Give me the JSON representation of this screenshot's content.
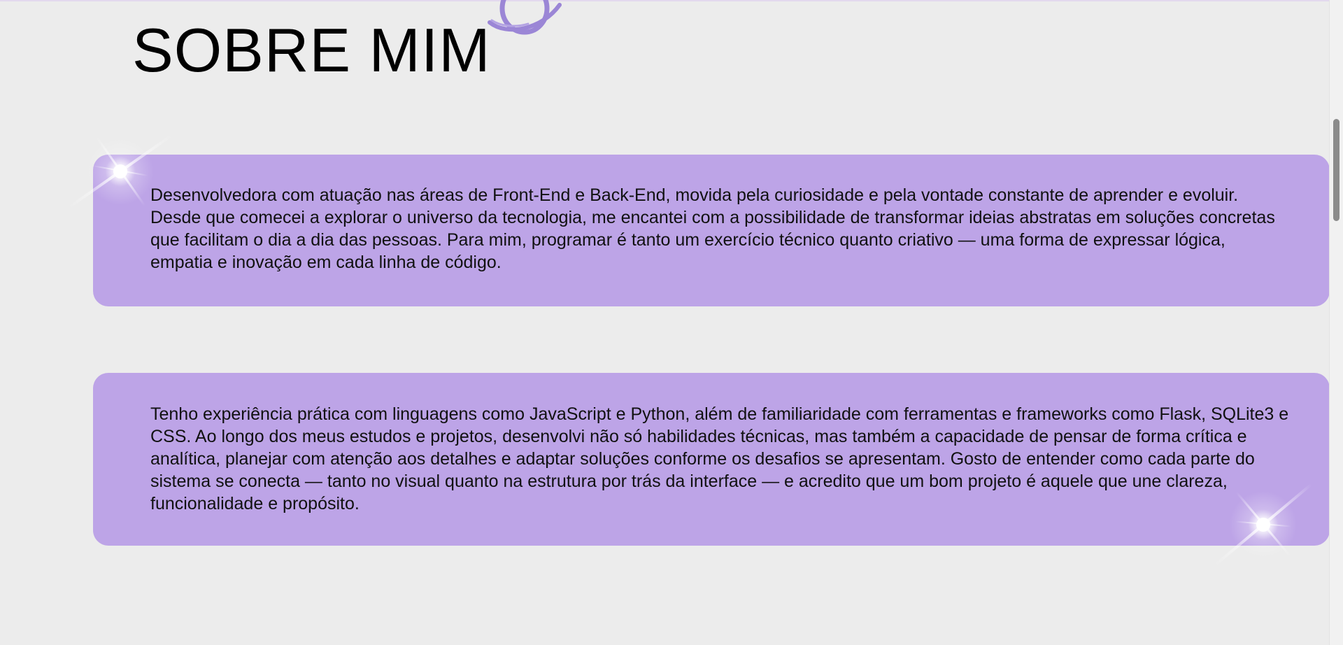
{
  "section": {
    "title": "SOBRE MIM"
  },
  "cards": [
    {
      "text": "Desenvolvedora com atuação nas áreas de Front-End e Back-End, movida pela curiosidade e pela vontade constante de aprender e evoluir. Desde que comecei a explorar o universo da tecnologia, me encantei com a possibilidade de transformar ideias abstratas em soluções concretas que facilitam o dia a dia das pessoas. Para mim, programar é tanto um exercício técnico quanto criativo — uma forma de expressar lógica, empatia e inovação em cada linha de código."
    },
    {
      "text": "Tenho experiência prática com linguagens como JavaScript e Python, além de familiaridade com ferramentas e frameworks como Flask, SQLite3 e CSS. Ao longo dos meus estudos e projetos, desenvolvi não só habilidades técnicas, mas também a capacidade de pensar de forma crítica e analítica, planejar com atenção aos detalhes e adaptar soluções conforme os desafios se apresentam. Gosto de entender como cada parte do sistema se conecta — tanto no visual quanto na estrutura por trás da interface — e acredito que um bom projeto é aquele que une clareza, funcionalidade e propósito."
    }
  ],
  "decorations": {
    "planet_icon": "planet-icon",
    "sparkle_icon": "sparkle-icon"
  },
  "colors": {
    "background": "#ececec",
    "card_background": "#bda4e7",
    "planet_stroke": "#9b86d6",
    "text": "#111111"
  },
  "scrollbar": {
    "position_fraction": 0.18
  }
}
